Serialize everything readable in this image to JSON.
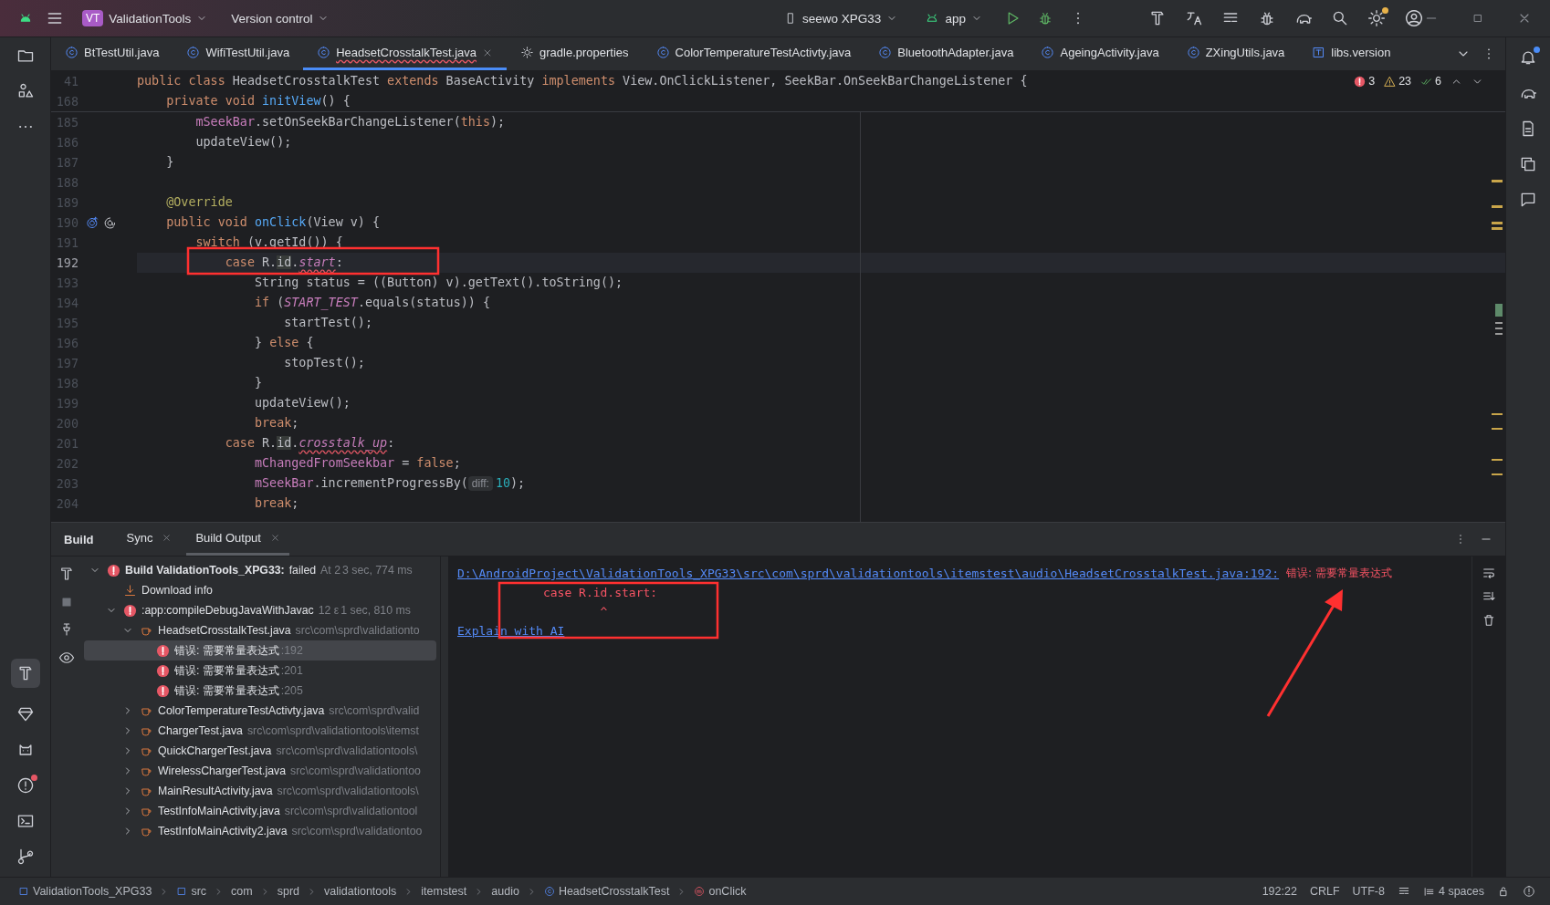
{
  "title_bar": {
    "project_badge": "VT",
    "project": "ValidationTools",
    "vcs": "Version control",
    "device": "seewo XPG33",
    "run_config": "app"
  },
  "editor_tabs": [
    {
      "label": "BtTestUtil.java",
      "kind": "class",
      "selected": false,
      "has_errors": false
    },
    {
      "label": "WifiTestUtil.java",
      "kind": "class",
      "selected": false,
      "has_errors": false
    },
    {
      "label": "HeadsetCrosstalkTest.java",
      "kind": "class",
      "selected": true,
      "has_errors": true
    },
    {
      "label": "gradle.properties",
      "kind": "gear",
      "selected": false,
      "has_errors": false
    },
    {
      "label": "ColorTemperatureTestActivty.java",
      "kind": "class",
      "selected": false,
      "has_errors": false
    },
    {
      "label": "BluetoothAdapter.java",
      "kind": "lib-class",
      "selected": false,
      "has_errors": false
    },
    {
      "label": "AgeingActivity.java",
      "kind": "lib-class",
      "selected": false,
      "has_errors": false
    },
    {
      "label": "ZXingUtils.java",
      "kind": "class",
      "selected": false,
      "has_errors": false
    },
    {
      "label": "libs.version",
      "kind": "text",
      "selected": false,
      "has_errors": false
    }
  ],
  "editor": {
    "problems": {
      "errors": "3",
      "warnings": "23",
      "ok": "6"
    },
    "sticky_lines": [
      {
        "number": "41",
        "tokens": [
          {
            "kind": "kw",
            "text": "public"
          },
          {
            "kind": "kw",
            "text": " class"
          },
          {
            "kind": "plain",
            "text": " HeadsetCrosstalkTest"
          },
          {
            "kind": "kw",
            "text": " extends"
          },
          {
            "kind": "plain",
            "text": " BaseActivity"
          },
          {
            "kind": "kw",
            "text": " implements"
          },
          {
            "kind": "plain",
            "text": " View.OnClickListener, SeekBar.OnSeekBarChangeListener {"
          }
        ]
      },
      {
        "number": "168",
        "tokens": [
          {
            "kind": "kw",
            "text": "    private"
          },
          {
            "kind": "kw",
            "text": " void"
          },
          {
            "kind": "fn",
            "text": " initView"
          },
          {
            "kind": "plain",
            "text": "() {"
          }
        ]
      }
    ],
    "lines": [
      {
        "number": "185",
        "current": false,
        "tokens": [
          {
            "kind": "field",
            "text": "        mSeekBar"
          },
          {
            "kind": "plain",
            "text": ".setOnSeekBarChangeListener("
          },
          {
            "kind": "kw",
            "text": "this"
          },
          {
            "kind": "plain",
            "text": ");"
          }
        ]
      },
      {
        "number": "186",
        "current": false,
        "tokens": [
          {
            "kind": "plain",
            "text": "        updateView();"
          }
        ]
      },
      {
        "number": "187",
        "current": false,
        "tokens": [
          {
            "kind": "plain",
            "text": "    }"
          }
        ]
      },
      {
        "number": "188",
        "current": false
      },
      {
        "number": "189",
        "current": false,
        "tokens": [
          {
            "kind": "ann",
            "text": "    @Override"
          }
        ]
      },
      {
        "number": "190",
        "current": false,
        "kind": "override",
        "tokens": [
          {
            "kind": "kw",
            "text": "    public"
          },
          {
            "kind": "kw",
            "text": " void"
          },
          {
            "kind": "fn",
            "text": " onClick"
          },
          {
            "kind": "plain",
            "text": "(View v) {"
          }
        ]
      },
      {
        "number": "191",
        "current": false,
        "tokens": [
          {
            "kind": "kw",
            "text": "        switch"
          },
          {
            "kind": "plain",
            "text": " (v.getId()) {"
          }
        ]
      },
      {
        "number": "192",
        "current": true,
        "tokens": [
          {
            "kind": "kw",
            "text": "            case"
          },
          {
            "kind": "plain",
            "text": " R."
          },
          {
            "kind": "usage",
            "text": "id"
          },
          {
            "kind": "plain",
            "text": "."
          },
          {
            "kind": "err-field",
            "text": "start"
          },
          {
            "kind": "plain",
            "text": ":"
          }
        ]
      },
      {
        "number": "193",
        "current": false,
        "tokens": [
          {
            "kind": "plain",
            "text": "                String status = ((Button) v).getText().toString();"
          }
        ]
      },
      {
        "number": "194",
        "current": false,
        "tokens": [
          {
            "kind": "kw",
            "text": "                if"
          },
          {
            "kind": "plain",
            "text": " ("
          },
          {
            "kind": "const",
            "text": "START_TEST"
          },
          {
            "kind": "plain",
            "text": ".equals(status)) {"
          }
        ]
      },
      {
        "number": "195",
        "current": false,
        "tokens": [
          {
            "kind": "plain",
            "text": "                    startTest();"
          }
        ]
      },
      {
        "number": "196",
        "current": false,
        "tokens": [
          {
            "kind": "plain",
            "text": "                } "
          },
          {
            "kind": "kw",
            "text": "else"
          },
          {
            "kind": "plain",
            "text": " {"
          }
        ]
      },
      {
        "number": "197",
        "current": false,
        "tokens": [
          {
            "kind": "plain",
            "text": "                    stopTest();"
          }
        ]
      },
      {
        "number": "198",
        "current": false,
        "tokens": [
          {
            "kind": "plain",
            "text": "                }"
          }
        ]
      },
      {
        "number": "199",
        "current": false,
        "tokens": [
          {
            "kind": "plain",
            "text": "                updateView();"
          }
        ]
      },
      {
        "number": "200",
        "current": false,
        "tokens": [
          {
            "kind": "kw",
            "text": "                break"
          },
          {
            "kind": "plain",
            "text": ";"
          }
        ]
      },
      {
        "number": "201",
        "current": false,
        "tokens": [
          {
            "kind": "kw",
            "text": "            case"
          },
          {
            "kind": "plain",
            "text": " R."
          },
          {
            "kind": "usage",
            "text": "id"
          },
          {
            "kind": "plain",
            "text": "."
          },
          {
            "kind": "err-field",
            "text": "crosstalk_up"
          },
          {
            "kind": "plain",
            "text": ":"
          }
        ]
      },
      {
        "number": "202",
        "current": false,
        "tokens": [
          {
            "kind": "field",
            "text": "                mChangedFromSeekbar"
          },
          {
            "kind": "plain",
            "text": " = "
          },
          {
            "kind": "kw",
            "text": "false"
          },
          {
            "kind": "plain",
            "text": ";"
          }
        ]
      },
      {
        "number": "203",
        "current": false,
        "tokens": [
          {
            "kind": "field",
            "text": "                mSeekBar"
          },
          {
            "kind": "plain",
            "text": ".incrementProgressBy("
          },
          {
            "kind": "hint",
            "text": "diff:"
          },
          {
            "kind": "num",
            "text": "10"
          },
          {
            "kind": "plain",
            "text": ");"
          }
        ]
      },
      {
        "number": "204",
        "current": false,
        "tokens": [
          {
            "kind": "kw",
            "text": "                break"
          },
          {
            "kind": "plain",
            "text": ";"
          }
        ]
      }
    ]
  },
  "build_panel": {
    "title": "Build",
    "tabs": [
      {
        "label": "Sync",
        "selected": false
      },
      {
        "label": "Build Output",
        "selected": true
      }
    ],
    "tree": [
      {
        "label": "Build ValidationTools_XPG33:",
        "status": "failed",
        "time": "At 2",
        "duration": "3 sec, 774 ms",
        "kind": "error",
        "expanded": true,
        "selected": false,
        "children": [
          {
            "label": "Download info",
            "kind": "download",
            "selected": false
          },
          {
            "label": ":app:compileDebugJavaWithJavac",
            "time": "12 ε",
            "duration": "1 sec, 810 ms",
            "kind": "error",
            "expanded": true,
            "selected": false,
            "children": [
              {
                "label": "HeadsetCrosstalkTest.java",
                "path": "src\\com\\sprd\\validationto",
                "kind": "java",
                "expanded": true,
                "selected": false,
                "children": [
                  {
                    "label": "错误: 需要常量表达式",
                    "line": ":192",
                    "kind": "error",
                    "selected": true
                  },
                  {
                    "label": "错误: 需要常量表达式",
                    "line": ":201",
                    "kind": "error",
                    "selected": false
                  },
                  {
                    "label": "错误: 需要常量表达式",
                    "line": ":205",
                    "kind": "error",
                    "selected": false
                  }
                ]
              },
              {
                "label": "ColorTemperatureTestActivty.java",
                "path": "src\\com\\sprd\\valid",
                "kind": "java",
                "expanded": false,
                "selected": false
              },
              {
                "label": "ChargerTest.java",
                "path": "src\\com\\sprd\\validationtools\\itemst",
                "kind": "java",
                "expanded": false,
                "selected": false
              },
              {
                "label": "QuickChargerTest.java",
                "path": "src\\com\\sprd\\validationtools\\",
                "kind": "java",
                "expanded": false,
                "selected": false
              },
              {
                "label": "WirelessChargerTest.java",
                "path": "src\\com\\sprd\\validationtoo",
                "kind": "java",
                "expanded": false,
                "selected": false
              },
              {
                "label": "MainResultActivity.java",
                "path": "src\\com\\sprd\\validationtools\\",
                "kind": "java",
                "expanded": false,
                "selected": false
              },
              {
                "label": "TestInfoMainActivity.java",
                "path": "src\\com\\sprd\\validationtool",
                "kind": "java",
                "expanded": false,
                "selected": false
              },
              {
                "label": "TestInfoMainActivity2.java",
                "path": "src\\com\\sprd\\validationtoo",
                "kind": "java",
                "expanded": false,
                "selected": false
              }
            ]
          }
        ]
      }
    ],
    "output": [
      {
        "kind": "link-error",
        "link": "D:\\AndroidProject\\ValidationTools_XPG33\\src\\com\\sprd\\validationtools\\itemstest\\audio\\HeadsetCrosstalkTest.java:192:",
        "message": "错误: 需要常量表达式"
      },
      {
        "kind": "error",
        "text": "            case R.id.start:"
      },
      {
        "kind": "error",
        "text": "                    ^"
      },
      {
        "kind": "link",
        "text": "Explain with AI"
      }
    ]
  },
  "status_bar": {
    "breadcrumbs": [
      {
        "label": "ValidationTools_XPG33",
        "kind": "module"
      },
      {
        "label": "src",
        "kind": "module"
      },
      {
        "label": "com"
      },
      {
        "label": "sprd"
      },
      {
        "label": "validationtools"
      },
      {
        "label": "itemstest"
      },
      {
        "label": "audio"
      },
      {
        "label": "HeadsetCrosstalkTest",
        "kind": "class"
      },
      {
        "label": "onClick",
        "kind": "method"
      }
    ],
    "position": "192:22",
    "line_separator": "CRLF",
    "encoding": "UTF-8",
    "indent": "4 spaces"
  }
}
